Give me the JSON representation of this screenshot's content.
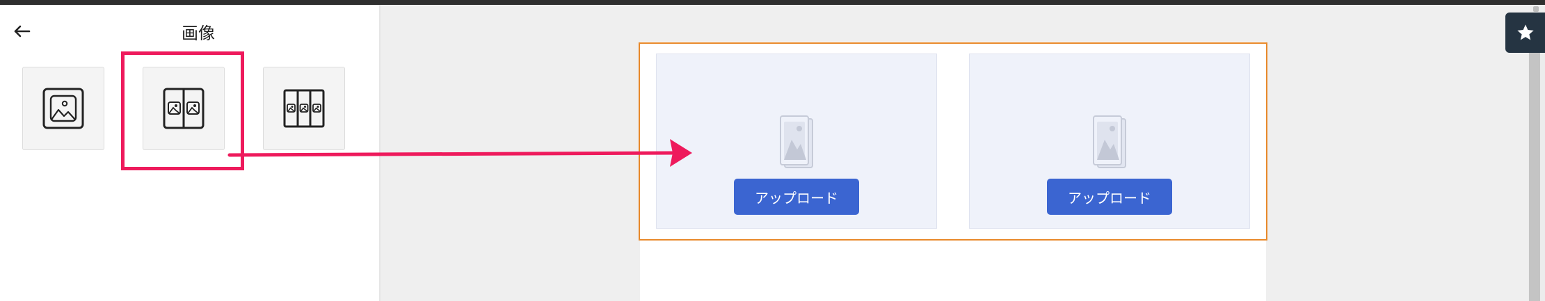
{
  "panel": {
    "back_icon": "arrow-left-icon",
    "title": "画像",
    "layouts": [
      {
        "icon": "image-single-icon"
      },
      {
        "icon": "image-two-column-icon",
        "selected": true
      },
      {
        "icon": "image-three-column-icon"
      }
    ]
  },
  "canvas": {
    "block": {
      "columns": [
        {
          "placeholder_icon": "image-placeholder-icon",
          "upload_label": "アップロード"
        },
        {
          "placeholder_icon": "image-placeholder-icon",
          "upload_label": "アップロード"
        }
      ]
    }
  },
  "toolbar": {
    "favorite_icon": "star-icon"
  },
  "colors": {
    "highlight": "#ee1a5c",
    "selection_border": "#e8892a",
    "upload_button": "#3b65d1",
    "star_button": "#253442"
  }
}
